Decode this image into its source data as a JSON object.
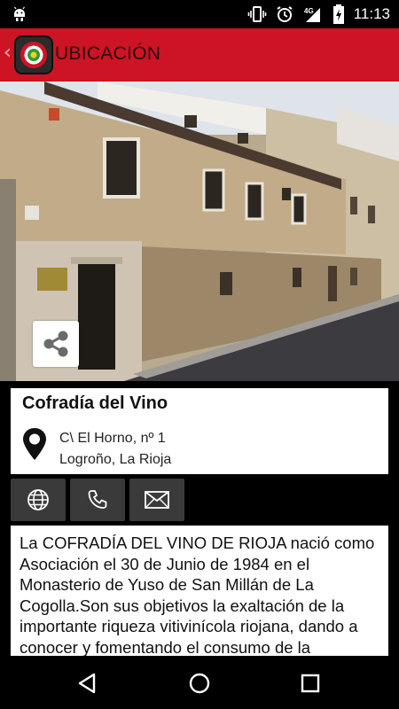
{
  "status_bar": {
    "time": "11:13",
    "network": "4G",
    "icons": [
      "android-icon",
      "vibrate-icon",
      "alarm-icon",
      "signal-icon",
      "battery-charging-icon"
    ]
  },
  "action_bar": {
    "title": "UBICACIÓN",
    "back_icon": "chevron-left-icon",
    "logo": "app-logo"
  },
  "place": {
    "name": "Cofradía del Vino",
    "address_line1": "C\\ El Horno, nº 1",
    "address_line2": "Logroño, La Rioja"
  },
  "actions": [
    {
      "name": "web",
      "icon": "globe-icon"
    },
    {
      "name": "phone",
      "icon": "phone-icon"
    },
    {
      "name": "email",
      "icon": "envelope-icon"
    }
  ],
  "description": "La COFRADÍA DEL VINO DE RIOJA nació como Asociación el 30 de Junio de 1984 en el Monasterio de Yuso de San Millán de La Cogolla.Son sus objetivos la exaltación de la importante riqueza vitivinícola riojana, dando a conocer y fomentando el consumo de la",
  "nav_bar": {
    "buttons": [
      "back-icon",
      "home-icon",
      "recents-icon"
    ]
  },
  "colors": {
    "accent": "#cc1424",
    "button_dark": "#3a3a3a"
  }
}
